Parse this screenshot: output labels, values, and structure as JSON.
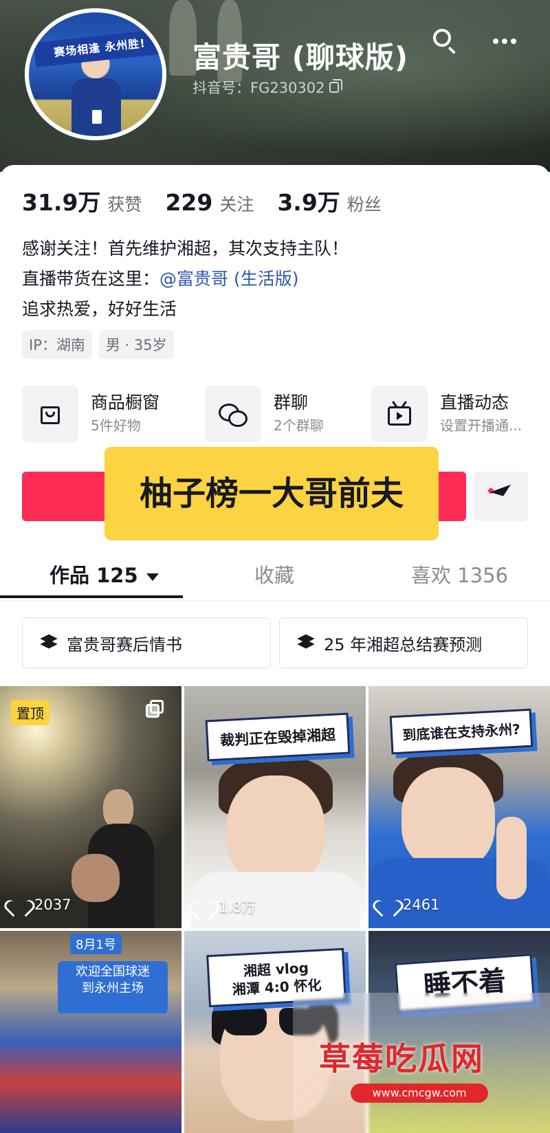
{
  "profile": {
    "name": "富贵哥 (聊球版)",
    "douyin_id": "抖音号：FG230302"
  },
  "avatar": {
    "banner_text": "赛场相逢 永州胜!"
  },
  "stats": [
    {
      "value": "31.9万",
      "label": "获赞"
    },
    {
      "value": "229",
      "label": "关注"
    },
    {
      "value": "3.9万",
      "label": "粉丝"
    }
  ],
  "bio": {
    "line1": "感谢关注！首先维护湘超，其次支持主队！",
    "line2_prefix": "直播带货在这里：",
    "line2_link": "@富贵哥 (生活版)",
    "line3": "追求热爱，好好生活"
  },
  "tags": [
    "IP：湖南",
    "男 · 35岁"
  ],
  "features": [
    {
      "title": "商品橱窗",
      "subtitle": "5件好物",
      "icon": "shopping-bag-icon"
    },
    {
      "title": "群聊",
      "subtitle": "2个群聊",
      "icon": "group-chat-icon"
    },
    {
      "title": "直播动态",
      "subtitle": "设置开播通...",
      "icon": "live-tv-icon"
    }
  ],
  "overlay_caption": "柚子榜一大哥前夫",
  "tabs": {
    "works": "作品 125",
    "favorites": "收藏",
    "likes": "喜欢 1356"
  },
  "collections": [
    "富贵哥赛后情书",
    "25 年湘超总结赛预测"
  ],
  "videos": [
    {
      "pinned_label": "置顶",
      "likes": "2037"
    },
    {
      "sticker": "裁判正在毁掉湘超",
      "likes": "1.8万"
    },
    {
      "sticker": "到底谁在支持永州?",
      "likes": "2461"
    },
    {
      "date_label": "8月1号",
      "caption_line1": "欢迎全国球迷",
      "caption_line2": "到永州主场"
    },
    {
      "sticker_line1": "湘超 vlog",
      "sticker_line2": "湘潭 4:0 怀化"
    },
    {
      "sticker": "睡不着"
    }
  ],
  "watermark": {
    "title": "草莓吃瓜网",
    "url": "www.cmcgw.com"
  },
  "colors": {
    "accent_red": "#fe2c55",
    "caption_yellow": "#fcd340",
    "link_blue": "#2d59a8"
  }
}
